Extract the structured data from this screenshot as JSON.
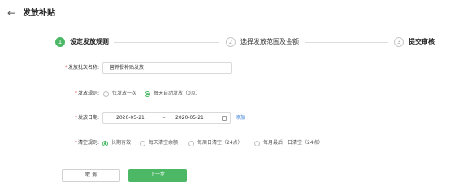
{
  "header": {
    "back_icon": "←",
    "title": "发放补贴"
  },
  "steps": [
    {
      "number": "1",
      "label": "设定发放规则",
      "active": true
    },
    {
      "number": "2",
      "label": "选择发放范围及金额",
      "active": false
    },
    {
      "number": "3",
      "label": "提交审核",
      "active": false
    }
  ],
  "form": {
    "batch_name": {
      "label": "发放批次名称:",
      "value": "营养餐补贴发放"
    },
    "issue_rule": {
      "label": "发放规则:",
      "options": [
        "仅发放一次",
        "每天自动发放（0点）"
      ],
      "selected": 1
    },
    "issue_date": {
      "label": "发放日期:",
      "start": "2020-05-21",
      "separator": "~",
      "end": "2020-05-21",
      "add_link": "添加"
    },
    "clear_rule": {
      "label": "清空规则:",
      "options": [
        "长期有效",
        "每天清空余额",
        "每周日清空（24点）",
        "每月最后一日清空（24点）"
      ],
      "selected": 0
    }
  },
  "actions": {
    "cancel_label": "取 消",
    "next_label": "下一步"
  },
  "colors": {
    "accent": "#4cb865",
    "link": "#3a7fd5",
    "required": "#e64340"
  }
}
